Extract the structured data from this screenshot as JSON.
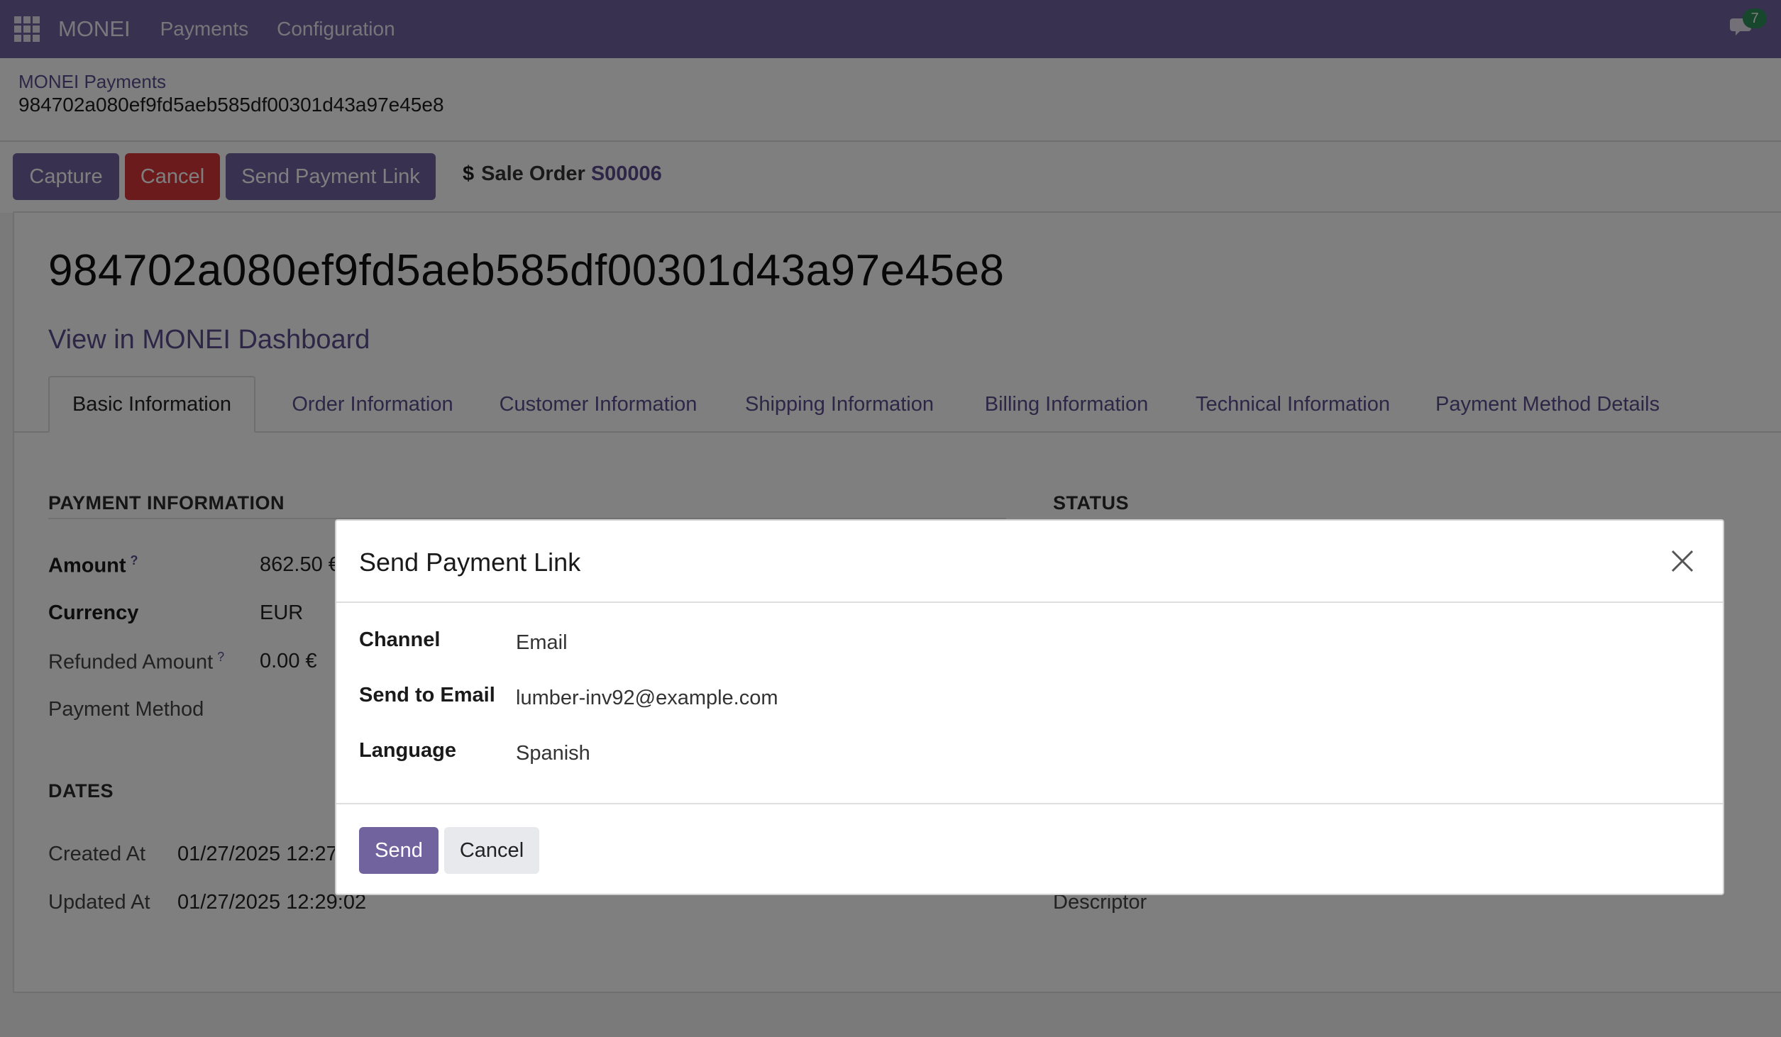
{
  "navbar": {
    "brand": "MONEI",
    "menu": [
      "Payments",
      "Configuration"
    ],
    "chat_badge": "7"
  },
  "breadcrumb": {
    "parent": "MONEI Payments",
    "current": "984702a080ef9fd5aeb585df00301d43a97e45e8"
  },
  "actions": {
    "capture": "Capture",
    "cancel": "Cancel",
    "send_link": "Send Payment Link",
    "sale_order_symbol": "$",
    "sale_order_label": "Sale Order",
    "sale_order_value": "S00006"
  },
  "record": {
    "title": "984702a080ef9fd5aeb585df00301d43a97e45e8",
    "dashboard_link": "View in MONEI Dashboard"
  },
  "tabs": [
    "Basic Information",
    "Order Information",
    "Customer Information",
    "Shipping Information",
    "Billing Information",
    "Technical Information",
    "Payment Method Details"
  ],
  "payment_info": {
    "title": "PAYMENT INFORMATION",
    "amount_label": "Amount",
    "amount_value": "862.50 €",
    "currency_label": "Currency",
    "currency_value": "EUR",
    "refunded_label": "Refunded Amount",
    "refunded_value": "0.00 €",
    "method_label": "Payment Method",
    "help_mark": "?"
  },
  "status": {
    "title": "STATUS",
    "descriptor_label": "Descriptor"
  },
  "dates": {
    "title": "DATES",
    "created_label": "Created At",
    "created_value": "01/27/2025 12:27",
    "updated_label": "Updated At",
    "updated_value": "01/27/2025 12:29:02"
  },
  "dialog": {
    "title": "Send Payment Link",
    "channel_label": "Channel",
    "channel_value": "Email",
    "email_label": "Send to Email",
    "email_value": "lumber-inv92@example.com",
    "language_label": "Language",
    "language_value": "Spanish",
    "send": "Send",
    "cancel": "Cancel"
  },
  "colors": {
    "brand": "#71639e",
    "danger": "#d9373a",
    "link": "#5c4d8e"
  }
}
